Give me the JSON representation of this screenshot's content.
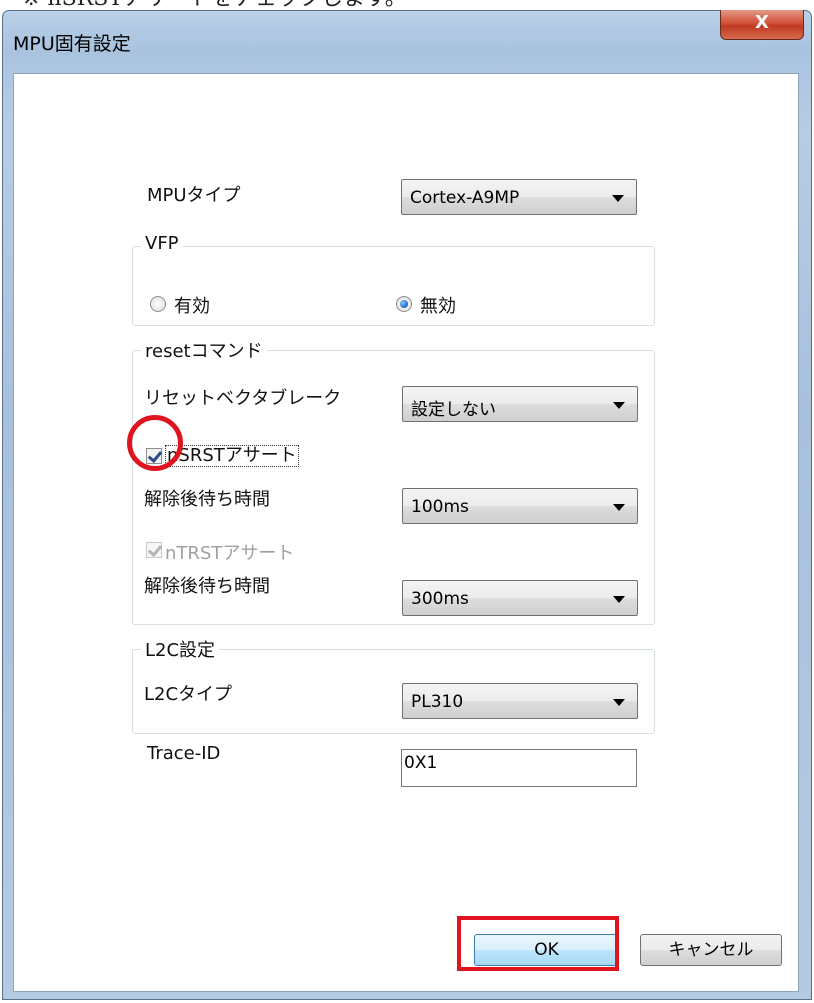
{
  "top_text": "※ nSRSTアサートをチェックします。",
  "window": {
    "title": "MPU固有設定",
    "close_label": "X"
  },
  "mpu_type": {
    "label": "MPUタイプ",
    "value": "Cortex-A9MP"
  },
  "vfp": {
    "title": "VFP",
    "enabled_label": "有効",
    "disabled_label": "無効",
    "selected": "無効"
  },
  "reset": {
    "title": "resetコマンド",
    "vector_break_label": "リセットベクタブレーク",
    "vector_break_value": "設定しない",
    "nsrst_label": "nSRSTアサート",
    "nsrst_checked": true,
    "nsrst_wait_label": "解除後待ち時間",
    "nsrst_wait_value": "100ms",
    "ntrst_label": "nTRSTアサート",
    "ntrst_checked": true,
    "ntrst_enabled": false,
    "ntrst_wait_label": "解除後待ち時間",
    "ntrst_wait_value": "300ms"
  },
  "l2c": {
    "title": "L2C設定",
    "type_label": "L2Cタイプ",
    "type_value": "PL310"
  },
  "trace": {
    "label": "Trace-ID",
    "value": "0X1"
  },
  "buttons": {
    "ok": "OK",
    "cancel": "キャンセル"
  },
  "colors": {
    "highlight": "#e0141e",
    "titlebar": "#b9d0e8",
    "close_button": "#c03a22"
  }
}
